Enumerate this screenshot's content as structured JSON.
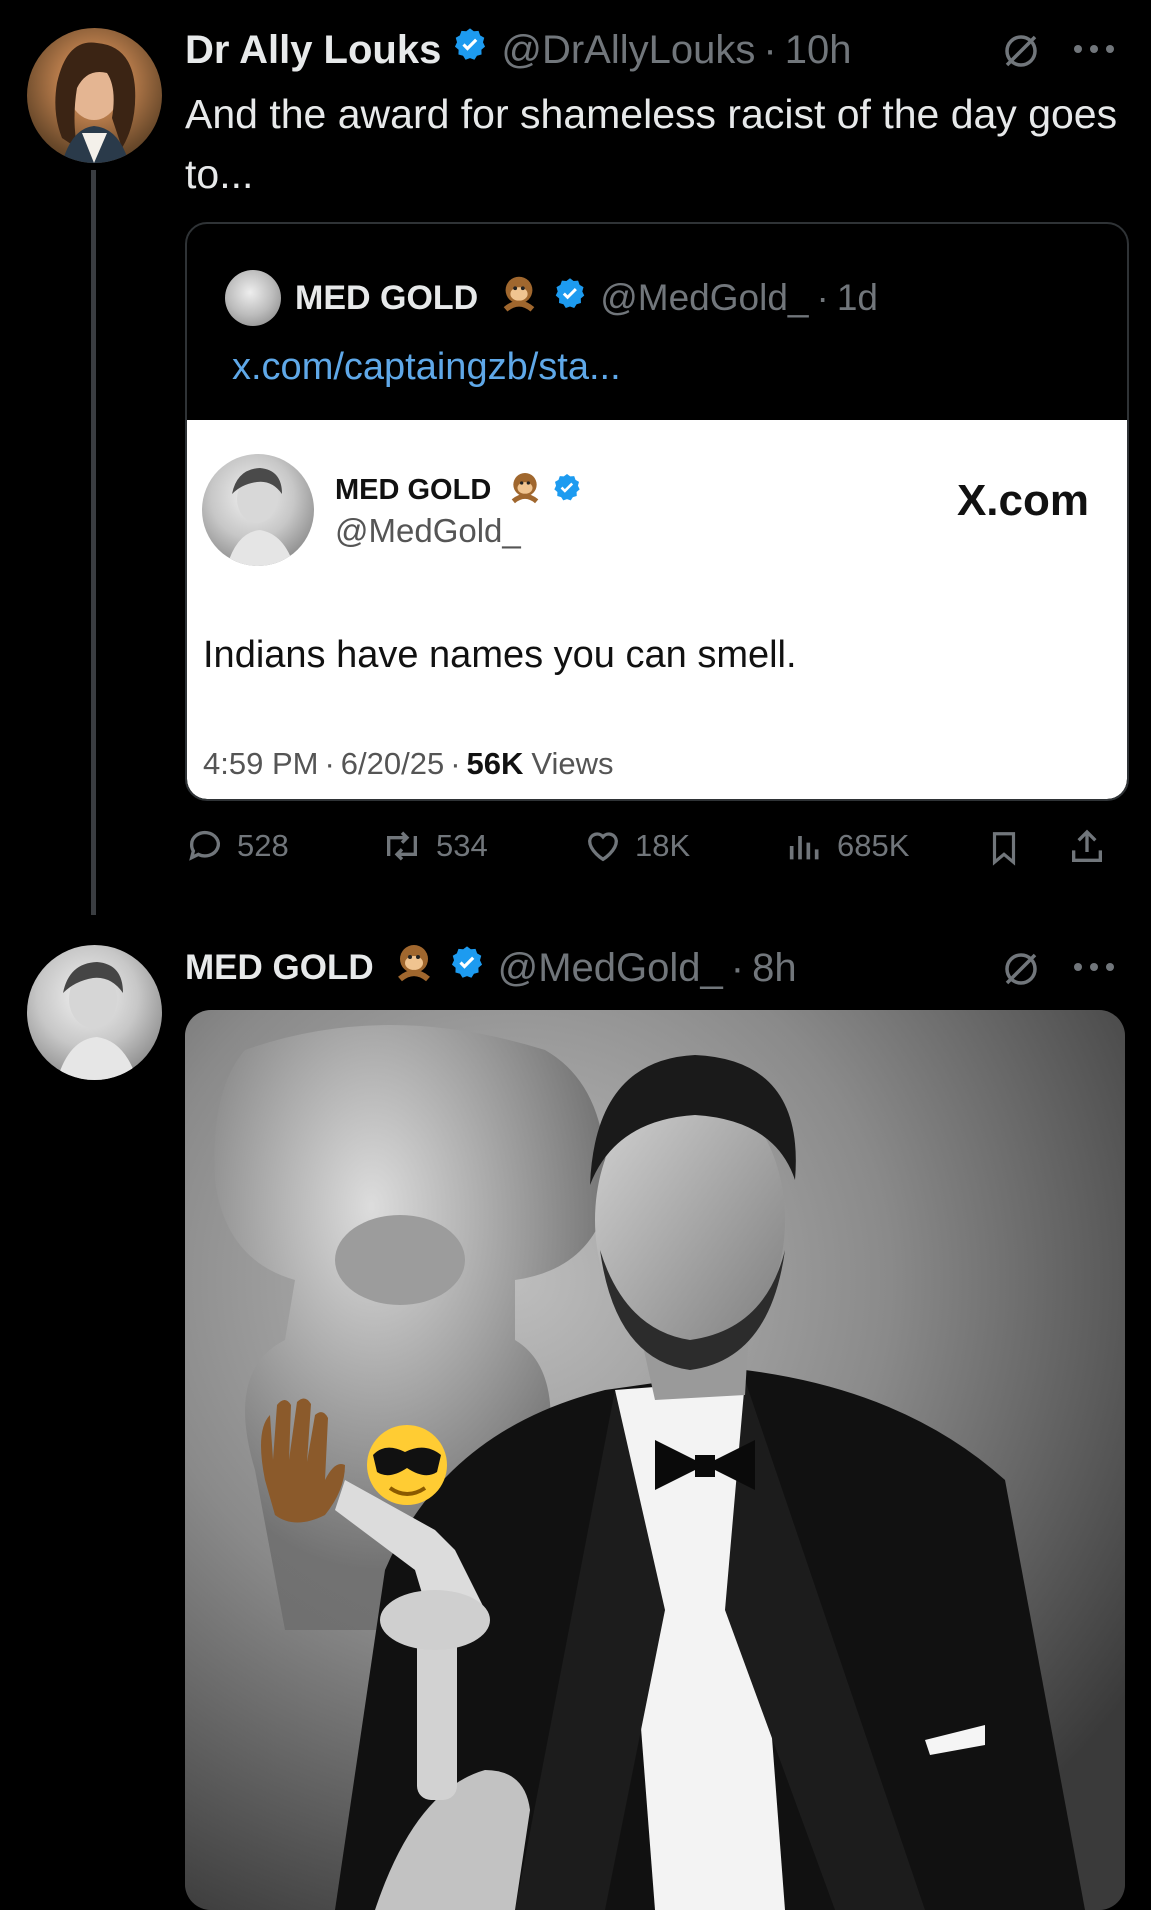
{
  "tweet1": {
    "display_name": "Dr Ally Louks",
    "handle": "@DrAllyLouks",
    "separator": "·",
    "time": "10h",
    "text": "And the award for shameless racist of the day goes to...",
    "quote": {
      "display_name": "MED GOLD",
      "handle": "@MedGold_",
      "time": "1d",
      "link": "x.com/captaingzb/sta...",
      "embed": {
        "display_name": "MED GOLD",
        "handle": "@MedGold_",
        "site_label": "X.com",
        "body": "Indians have names you can smell.",
        "time": "4:59 PM",
        "date": "6/20/25",
        "views_count": "56K",
        "views_label": "Views"
      }
    },
    "actions": {
      "replies": "528",
      "reposts": "534",
      "likes": "18K",
      "views": "685K"
    }
  },
  "tweet2": {
    "display_name": "MED GOLD",
    "handle": "@MedGold_",
    "time": "8h"
  },
  "colors": {
    "background": "#000000",
    "text": "#e7e9ea",
    "muted": "#71767b",
    "verified": "#1d9bf0",
    "divider": "#2f3336"
  },
  "icons": {
    "verified": "verified-badge-icon",
    "grok": "grok-icon",
    "more": "more-icon",
    "reply": "reply-icon",
    "repost": "repost-icon",
    "like": "like-icon",
    "views": "views-icon",
    "bookmark": "bookmark-icon",
    "share": "share-icon",
    "monkey": "monkey-emoji"
  }
}
